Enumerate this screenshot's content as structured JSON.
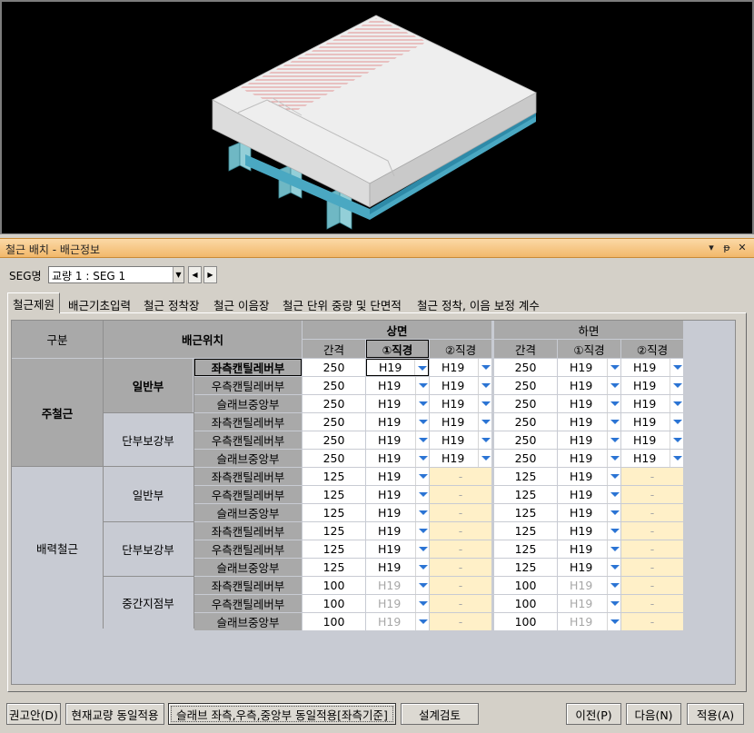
{
  "panel": {
    "title": "철근 배치 - 배근정보",
    "controls": {
      "dropdown": "▾",
      "pin": "ᵽ",
      "close": "✕"
    }
  },
  "seg": {
    "label": "SEG명",
    "value": "교량 1 : SEG 1",
    "prev": "◀",
    "next": "▶"
  },
  "tabs": [
    {
      "label": "철근제원",
      "active": true
    },
    {
      "label": "배근기초입력"
    },
    {
      "label": "철근 정착장"
    },
    {
      "label": "철근 이음장"
    },
    {
      "label": "철근 단위 중량 및 단면적"
    },
    {
      "label": "철근 정착, 이음 보정 계수"
    }
  ],
  "table": {
    "headers": {
      "category": "구분",
      "position": "배근위치",
      "upper": "상면",
      "lower": "하면",
      "spacing": "간격",
      "dia1": "①직경",
      "dia2": "②직경"
    },
    "main": {
      "label": "주철근",
      "groups": [
        {
          "label": "일반부",
          "rows": [
            {
              "pos": "좌측캔틸레버부",
              "u_sp": "250",
              "u_d1": "H19",
              "u_d2": "H19",
              "l_sp": "250",
              "l_d1": "H19",
              "l_d2": "H19"
            },
            {
              "pos": "우측캔틸레버부",
              "u_sp": "250",
              "u_d1": "H19",
              "u_d2": "H19",
              "l_sp": "250",
              "l_d1": "H19",
              "l_d2": "H19"
            },
            {
              "pos": "슬래브중앙부",
              "u_sp": "250",
              "u_d1": "H19",
              "u_d2": "H19",
              "l_sp": "250",
              "l_d1": "H19",
              "l_d2": "H19"
            }
          ]
        },
        {
          "label": "단부보강부",
          "rows": [
            {
              "pos": "좌측캔틸레버부",
              "u_sp": "250",
              "u_d1": "H19",
              "u_d2": "H19",
              "l_sp": "250",
              "l_d1": "H19",
              "l_d2": "H19"
            },
            {
              "pos": "우측캔틸레버부",
              "u_sp": "250",
              "u_d1": "H19",
              "u_d2": "H19",
              "l_sp": "250",
              "l_d1": "H19",
              "l_d2": "H19"
            },
            {
              "pos": "슬래브중앙부",
              "u_sp": "250",
              "u_d1": "H19",
              "u_d2": "H19",
              "l_sp": "250",
              "l_d1": "H19",
              "l_d2": "H19"
            }
          ]
        }
      ]
    },
    "dist": {
      "label": "배력철근",
      "groups": [
        {
          "label": "일반부",
          "rows": [
            {
              "pos": "좌측캔틸레버부",
              "u_sp": "125",
              "u_d1": "H19",
              "u_d2": "-",
              "l_sp": "125",
              "l_d1": "H19",
              "l_d2": "-"
            },
            {
              "pos": "우측캔틸레버부",
              "u_sp": "125",
              "u_d1": "H19",
              "u_d2": "-",
              "l_sp": "125",
              "l_d1": "H19",
              "l_d2": "-"
            },
            {
              "pos": "슬래브중앙부",
              "u_sp": "125",
              "u_d1": "H19",
              "u_d2": "-",
              "l_sp": "125",
              "l_d1": "H19",
              "l_d2": "-"
            }
          ]
        },
        {
          "label": "단부보강부",
          "rows": [
            {
              "pos": "좌측캔틸레버부",
              "u_sp": "125",
              "u_d1": "H19",
              "u_d2": "-",
              "l_sp": "125",
              "l_d1": "H19",
              "l_d2": "-"
            },
            {
              "pos": "우측캔틸레버부",
              "u_sp": "125",
              "u_d1": "H19",
              "u_d2": "-",
              "l_sp": "125",
              "l_d1": "H19",
              "l_d2": "-"
            },
            {
              "pos": "슬래브중앙부",
              "u_sp": "125",
              "u_d1": "H19",
              "u_d2": "-",
              "l_sp": "125",
              "l_d1": "H19",
              "l_d2": "-"
            }
          ]
        },
        {
          "label": "중간지점부",
          "rows": [
            {
              "pos": "좌측캔틸레버부",
              "u_sp": "100",
              "u_d1": "H19",
              "u_d2": "-",
              "l_sp": "100",
              "l_d1": "H19",
              "l_d2": "-"
            },
            {
              "pos": "우측캔틸레버부",
              "u_sp": "100",
              "u_d1": "H19",
              "u_d2": "-",
              "l_sp": "100",
              "l_d1": "H19",
              "l_d2": "-"
            },
            {
              "pos": "슬래브중앙부",
              "u_sp": "100",
              "u_d1": "H19",
              "u_d2": "-",
              "l_sp": "100",
              "l_d1": "H19",
              "l_d2": "-"
            }
          ]
        }
      ]
    }
  },
  "buttons": {
    "recommend": "권고안(D)",
    "apply_same_bridge": "현재교량 동일적용",
    "apply_slab": "슬래브 좌측,우측,중앙부 동일적용[좌측기준]",
    "design_check": "설계검토",
    "prev": "이전(P)",
    "next": "다음(N)",
    "apply": "적용(A)"
  },
  "colors": {
    "titlebar": "#f2b86a",
    "header_gray": "#a9a9a9",
    "disabled_yellow": "#fff0c8",
    "dropdown_blue": "#2b74d4"
  }
}
